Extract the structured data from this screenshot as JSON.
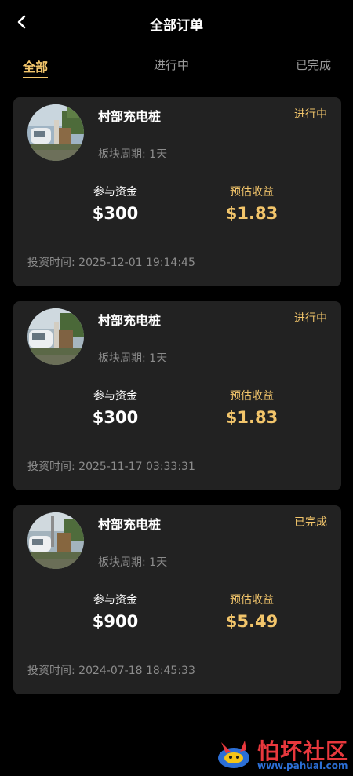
{
  "header": {
    "title": "全部订单"
  },
  "tabs": [
    {
      "label": "全部"
    },
    {
      "label": "进行中"
    },
    {
      "label": "已完成"
    }
  ],
  "labels": {
    "invested_label": "参与资金",
    "earnings_label": "预估收益"
  },
  "orders": [
    {
      "name": "村部充电桩",
      "status": "进行中",
      "period": "板块周期: 1天",
      "invested": "$300",
      "earnings": "$1.83",
      "time": "投资时间: 2025-12-01 19:14:45"
    },
    {
      "name": "村部充电桩",
      "status": "进行中",
      "period": "板块周期: 1天",
      "invested": "$300",
      "earnings": "$1.83",
      "time": "投资时间: 2025-11-17 03:33:31"
    },
    {
      "name": "村部充电桩",
      "status": "已完成",
      "period": "板块周期: 1天",
      "invested": "$900",
      "earnings": "$5.49",
      "time": "投资时间: 2024-07-18 18:45:33"
    }
  ],
  "watermark": {
    "text": "怕坏社区",
    "url": "www.pahuai.com"
  },
  "colors": {
    "background": "#000000",
    "card": "#222222",
    "accent": "#f2c56b",
    "muted": "#8c8c8c"
  }
}
